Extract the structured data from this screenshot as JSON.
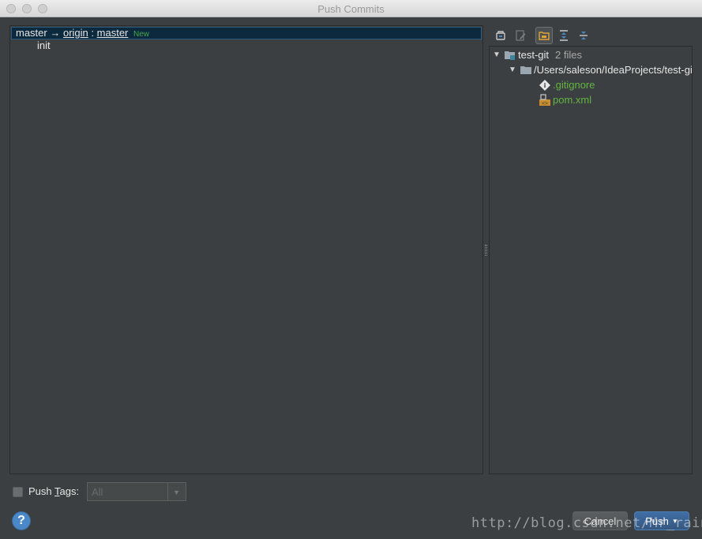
{
  "window": {
    "title": "Push Commits"
  },
  "commits": {
    "branch": "master",
    "arrow": "→",
    "remote": "origin",
    "colon": ":",
    "target_branch": "master",
    "badge": "New",
    "items": [
      {
        "message": "init"
      }
    ]
  },
  "toolbar": {
    "icons": [
      "branch-icon",
      "edit-source-icon",
      "group-by-directory-icon",
      "expand-all-icon",
      "collapse-all-icon"
    ]
  },
  "tree": {
    "root": {
      "name": "test-git",
      "count": "2 files"
    },
    "folder": {
      "path": "/Users/saleson/IdeaProjects/test-git"
    },
    "files": [
      {
        "name": ".gitignore",
        "icon": "gitignore-icon"
      },
      {
        "name": "pom.xml",
        "icon": "maven-icon"
      }
    ]
  },
  "footer": {
    "push_tags_label_pre": "Push ",
    "push_tags_label_mnemonic": "T",
    "push_tags_label_post": "ags:",
    "push_tags_checked": false,
    "tags_value": "All",
    "cancel_label": "Cancel",
    "push_label": "Push",
    "help": "?"
  },
  "watermark": "http://blog.csdn.net/Mr_rain",
  "colors": {
    "background": "#3c3f41",
    "selection": "#0d293e",
    "new_badge": "#48a74b",
    "file_added": "#62b543",
    "primary_button": "#365880"
  }
}
